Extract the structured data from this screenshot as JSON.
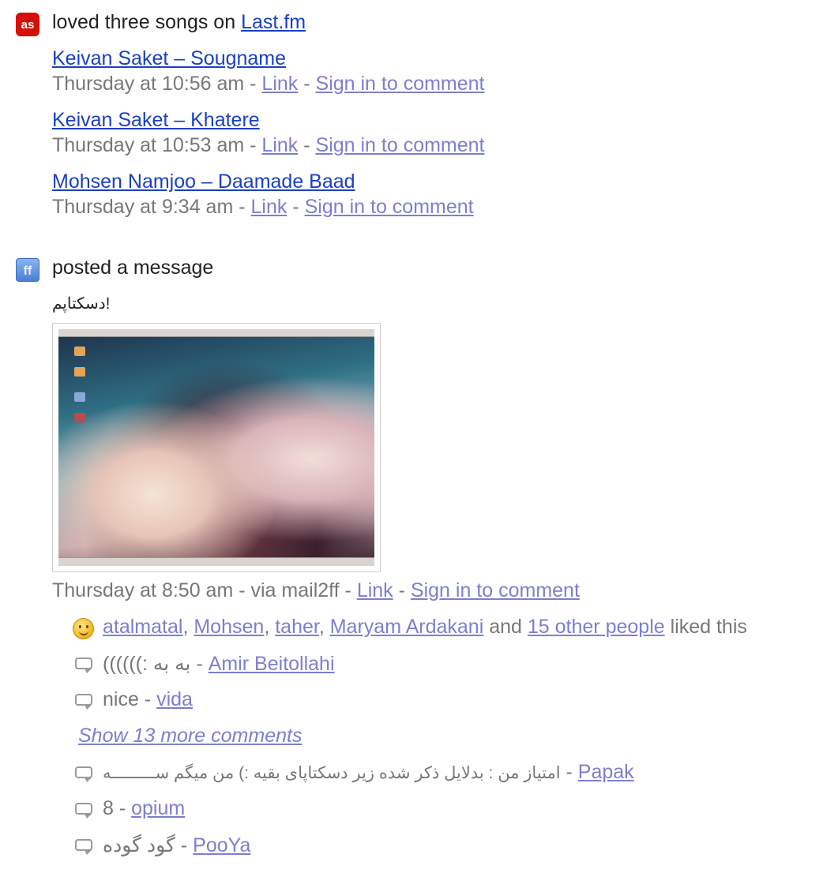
{
  "lastfm_entry": {
    "action_text": "loved three songs on",
    "service_link": "Last.fm",
    "songs": [
      {
        "title": "Keivan Saket – Sougname",
        "time": "Thursday at 10:56 am",
        "link": "Link",
        "comment": "Sign in to comment"
      },
      {
        "title": "Keivan Saket – Khatere",
        "time": "Thursday at 10:53 am",
        "link": "Link",
        "comment": "Sign in to comment"
      },
      {
        "title": "Mohsen Namjoo – Daamade Baad",
        "time": "Thursday at 9:34 am",
        "link": "Link",
        "comment": "Sign in to comment"
      }
    ]
  },
  "ff_entry": {
    "action_text": "posted a message",
    "message": "!دسکتاپم",
    "time": "Thursday at 8:50 am - via mail2ff",
    "link": "Link",
    "comment": "Sign in to comment",
    "likes": {
      "names": [
        "atalmatal",
        "Mohsen",
        "taher",
        "Maryam Ardakani"
      ],
      "and_text": "and",
      "others_link": "15 other people",
      "suffix": "liked this"
    },
    "comments_before": [
      {
        "text": "به به :))))))",
        "author": "Amir Beitollahi"
      },
      {
        "text": "nice",
        "author": "vida"
      }
    ],
    "show_more": "Show 13 more comments",
    "comments_after": [
      {
        "text": "امتیاز من : بدلایل ذکر شده زیر دسکتاپای بقیه :) من میگم ســـــــــه",
        "author": "Papak"
      },
      {
        "text": "8",
        "author": "opium"
      },
      {
        "text": "گود گوده",
        "author": "PooYa"
      }
    ]
  },
  "colors": {
    "link": "#1a3fc4",
    "visited_link": "#7b7fcf",
    "meta_gray": "#777777",
    "lastfm_red": "#d51007"
  },
  "icons": [
    "lastfm-icon",
    "friendfeed-icon",
    "smiley-icon",
    "comment-bubble-icon"
  ]
}
